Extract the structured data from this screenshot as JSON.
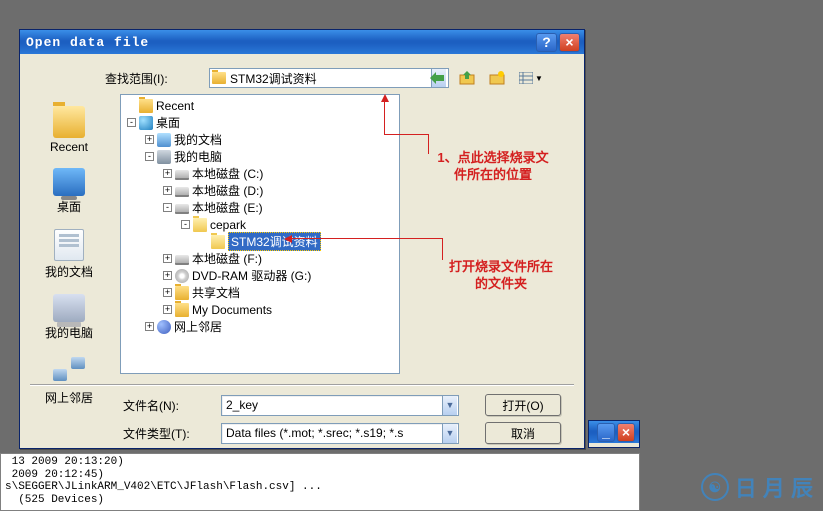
{
  "dialog": {
    "title": "Open data file",
    "lookin_label": "查找范围(I):",
    "lookin_value": "STM32调试资料",
    "filename_label": "文件名(N):",
    "filename_value": "2_key",
    "filetype_label": "文件类型(T):",
    "filetype_value": "Data files (*.mot; *.srec; *.s19; *.s",
    "open_btn": "打开(O)",
    "cancel_btn": "取消"
  },
  "places": [
    {
      "label": "Recent",
      "icon": "pi-recent"
    },
    {
      "label": "桌面",
      "icon": "pi-desktop"
    },
    {
      "label": "我的文档",
      "icon": "pi-docs"
    },
    {
      "label": "我的电脑",
      "icon": "pi-pc"
    },
    {
      "label": "网上邻居",
      "icon": "pi-net"
    }
  ],
  "tree": [
    {
      "indent": 0,
      "toggle": "",
      "icon": "folder-ico",
      "label": "Recent"
    },
    {
      "indent": 0,
      "toggle": "-",
      "icon": "desktop-ico",
      "label": "桌面"
    },
    {
      "indent": 1,
      "toggle": "+",
      "icon": "docs-ico",
      "label": "我的文档"
    },
    {
      "indent": 1,
      "toggle": "-",
      "icon": "pc-ico",
      "label": "我的电脑"
    },
    {
      "indent": 2,
      "toggle": "+",
      "icon": "drive-ico",
      "label": "本地磁盘 (C:)"
    },
    {
      "indent": 2,
      "toggle": "+",
      "icon": "drive-ico",
      "label": "本地磁盘 (D:)"
    },
    {
      "indent": 2,
      "toggle": "-",
      "icon": "drive-ico",
      "label": "本地磁盘 (E:)"
    },
    {
      "indent": 3,
      "toggle": "-",
      "icon": "folder-open-ico",
      "label": "cepark"
    },
    {
      "indent": 4,
      "toggle": "",
      "icon": "folder-open-ico",
      "label": "STM32调试资料",
      "selected": true
    },
    {
      "indent": 2,
      "toggle": "+",
      "icon": "drive-ico",
      "label": "本地磁盘 (F:)"
    },
    {
      "indent": 2,
      "toggle": "+",
      "icon": "dvd-ico",
      "label": "DVD-RAM 驱动器 (G:)"
    },
    {
      "indent": 2,
      "toggle": "+",
      "icon": "folder-ico",
      "label": "共享文档"
    },
    {
      "indent": 2,
      "toggle": "+",
      "icon": "folder-ico",
      "label": "My Documents"
    },
    {
      "indent": 1,
      "toggle": "+",
      "icon": "network-ico",
      "label": "网上邻居"
    }
  ],
  "annotations": {
    "a1_line1": "1、点此选择烧录文",
    "a1_line2": "件所在的位置",
    "a2_line1": "打开烧录文件所在",
    "a2_line2": "的文件夹"
  },
  "console": {
    "l1": " 13 2009 20:13:20)",
    "l2": " 2009 20:12:45)",
    "l3": "s\\SEGGER\\JLinkARM_V402\\ETC\\JFlash\\Flash.csv] ...",
    "l4": "  (525 Devices)"
  },
  "watermark": "日 月 辰"
}
